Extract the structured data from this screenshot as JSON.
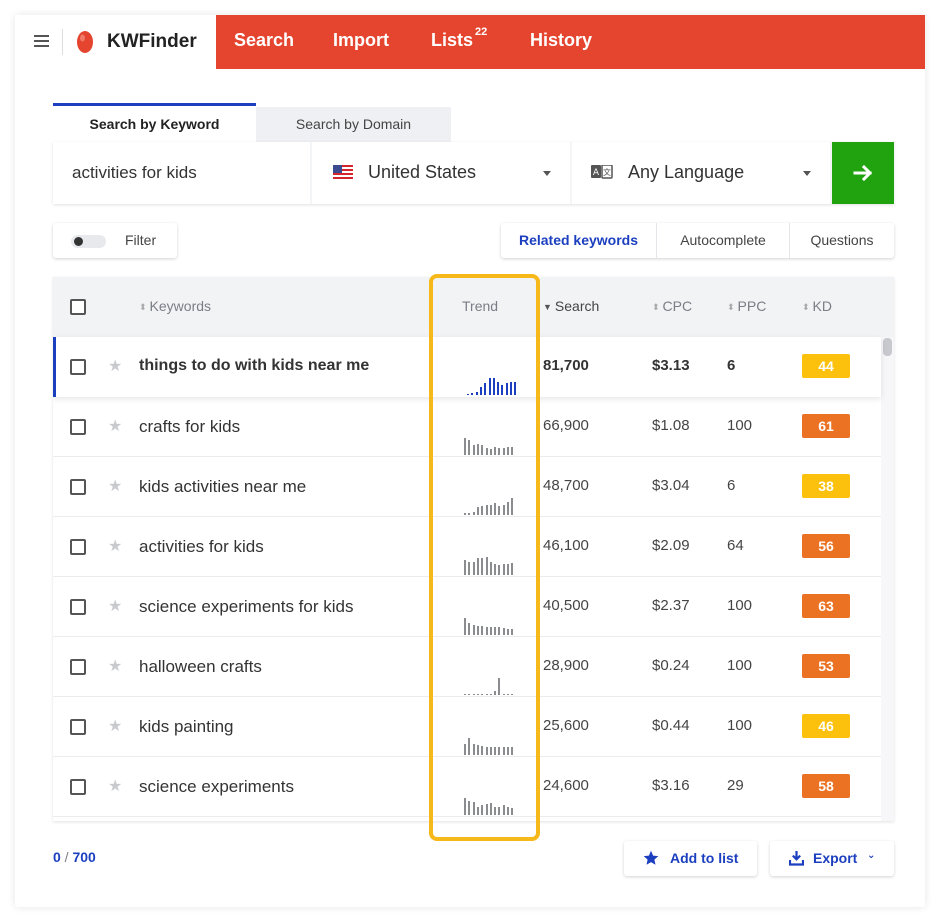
{
  "app": {
    "name": "KWFinder"
  },
  "nav": {
    "search": "Search",
    "import": "Import",
    "lists": "Lists",
    "lists_count": "22",
    "history": "History"
  },
  "search_tabs": {
    "by_keyword": "Search by Keyword",
    "by_domain": "Search by Domain"
  },
  "search": {
    "keyword_value": "activities for kids",
    "location": "United States",
    "language": "Any Language",
    "flag_icon": "us-flag-icon",
    "language_icon": "translate-icon"
  },
  "filter": {
    "label": "Filter",
    "enabled": false
  },
  "keyword_tabs": {
    "related": "Related keywords",
    "autocomplete": "Autocomplete",
    "questions": "Questions"
  },
  "table": {
    "headers": {
      "keywords": "Keywords",
      "trend": "Trend",
      "search": "Search",
      "cpc": "CPC",
      "ppc": "PPC",
      "kd": "KD"
    },
    "rows": [
      {
        "keyword": "things to do with kids near me",
        "search": "81,700",
        "cpc": "$3.13",
        "ppc": "6",
        "kd": "44",
        "trend": [
          0.05,
          0.1,
          0.15,
          0.35,
          0.55,
          0.75,
          0.75,
          0.6,
          0.45,
          0.55,
          0.6,
          0.6
        ]
      },
      {
        "keyword": "crafts for kids",
        "search": "66,900",
        "cpc": "$1.08",
        "ppc": "100",
        "kd": "61",
        "trend": [
          0.75,
          0.7,
          0.45,
          0.5,
          0.45,
          0.3,
          0.25,
          0.35,
          0.3,
          0.3,
          0.35,
          0.35
        ]
      },
      {
        "keyword": "kids activities near me",
        "search": "48,700",
        "cpc": "$3.04",
        "ppc": "6",
        "kd": "38",
        "trend": [
          0.1,
          0.1,
          0.15,
          0.35,
          0.4,
          0.45,
          0.45,
          0.55,
          0.4,
          0.45,
          0.6,
          0.75
        ]
      },
      {
        "keyword": "activities for kids",
        "search": "46,100",
        "cpc": "$2.09",
        "ppc": "64",
        "kd": "56",
        "trend": [
          0.7,
          0.6,
          0.6,
          0.75,
          0.75,
          0.8,
          0.6,
          0.5,
          0.45,
          0.5,
          0.5,
          0.55
        ]
      },
      {
        "keyword": "science experiments for kids",
        "search": "40,500",
        "cpc": "$2.37",
        "ppc": "100",
        "kd": "63",
        "trend": [
          0.75,
          0.55,
          0.45,
          0.4,
          0.4,
          0.35,
          0.35,
          0.35,
          0.35,
          0.3,
          0.25,
          0.25
        ]
      },
      {
        "keyword": "halloween crafts",
        "search": "28,900",
        "cpc": "$0.24",
        "ppc": "100",
        "kd": "53",
        "trend": [
          0.05,
          0.05,
          0.05,
          0.05,
          0.05,
          0.05,
          0.05,
          0.2,
          0.75,
          0.05,
          0.05,
          0.05
        ]
      },
      {
        "keyword": "kids painting",
        "search": "25,600",
        "cpc": "$0.44",
        "ppc": "100",
        "kd": "46",
        "trend": [
          0.5,
          0.75,
          0.5,
          0.45,
          0.4,
          0.35,
          0.35,
          0.35,
          0.35,
          0.35,
          0.35,
          0.35
        ]
      },
      {
        "keyword": "science experiments",
        "search": "24,600",
        "cpc": "$3.16",
        "ppc": "29",
        "kd": "58",
        "trend": [
          0.75,
          0.65,
          0.6,
          0.35,
          0.45,
          0.5,
          0.55,
          0.35,
          0.35,
          0.45,
          0.35,
          0.3
        ]
      }
    ]
  },
  "footer": {
    "selected": "0",
    "total": "700",
    "add_to_list": "Add to list",
    "export": "Export"
  },
  "colors": {
    "accent": "#1b3fbf",
    "nav_bg": "#e5442f",
    "go_button": "#21a30f",
    "highlight": "#f7b819",
    "kd_yellow": "#fbc10c",
    "kd_orange": "#ec7223",
    "trend_active": "#1b3fbf",
    "trend_default": "#8a8c90"
  }
}
